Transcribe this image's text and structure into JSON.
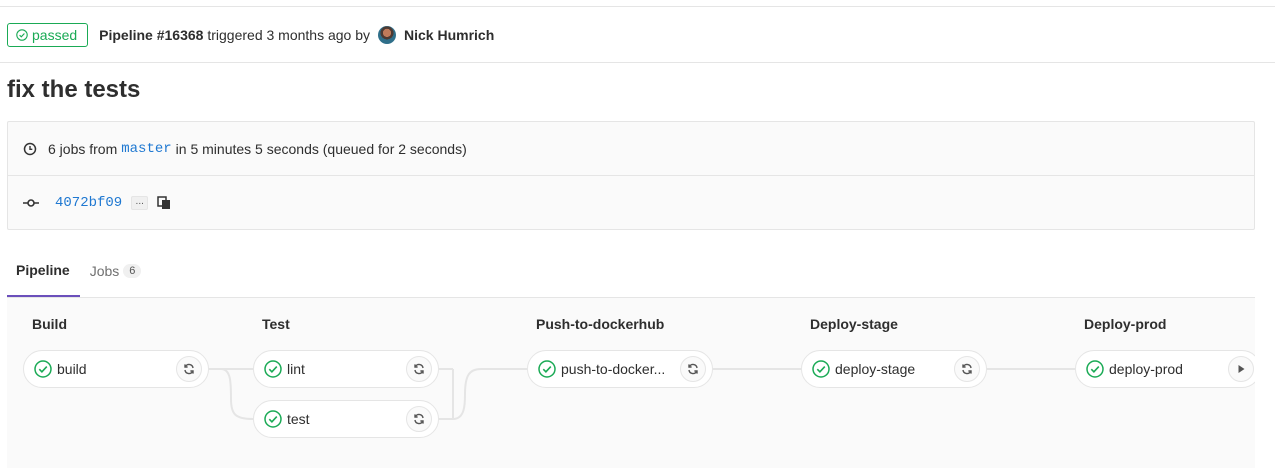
{
  "header": {
    "status": "passed",
    "pipeline": "Pipeline #16368",
    "triggered": "triggered 3 months ago by",
    "author": "Nick Humrich"
  },
  "title": "fix the tests",
  "info": {
    "jobs_prefix": "6 jobs from",
    "branch": "master",
    "duration": "in 5 minutes 5 seconds (queued for 2 seconds)",
    "sha": "4072bf09",
    "ellipsis": "..."
  },
  "tabs": [
    {
      "label": "Pipeline"
    },
    {
      "label": "Jobs",
      "count": "6"
    }
  ],
  "stages": [
    {
      "name": "Build",
      "jobs": [
        "build"
      ]
    },
    {
      "name": "Test",
      "jobs": [
        "lint",
        "test"
      ]
    },
    {
      "name": "Push-to-dockerhub",
      "jobs": [
        "push-to-docker..."
      ]
    },
    {
      "name": "Deploy-stage",
      "jobs": [
        "deploy-stage"
      ]
    },
    {
      "name": "Deploy-prod",
      "jobs": [
        "deploy-prod"
      ]
    }
  ],
  "colors": {
    "success": "#1aaa55",
    "link": "#1f78d1",
    "active_tab": "#6b4fbb"
  },
  "icons": {
    "status": "check-circle-icon",
    "retry": "retry-icon",
    "play": "play-icon",
    "clock": "clock-icon",
    "commit": "commit-icon",
    "copy": "copy-icon"
  }
}
